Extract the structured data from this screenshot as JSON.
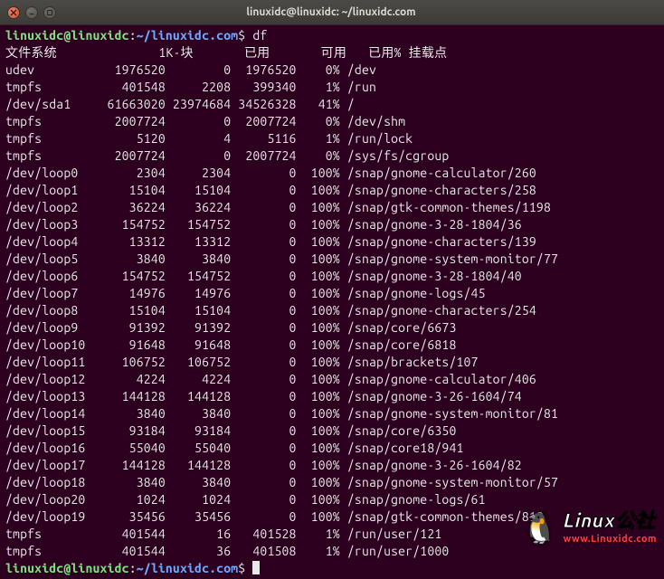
{
  "window": {
    "title": "linuxidc@linuxidc: ~/linuxidc.com"
  },
  "prompt": {
    "user_host": "linuxidc@linuxidc",
    "colon": ":",
    "path": "~/linuxidc.com",
    "dollar": "$",
    "command": "df"
  },
  "headers": {
    "filesystem": "文件系统",
    "blocks": "1K-块",
    "used": "已用",
    "avail": "可用",
    "pct": "已用%",
    "mount": "挂载点"
  },
  "rows": [
    {
      "fs": "udev",
      "blk": "1976520",
      "used": "0",
      "avail": "1976520",
      "pct": "0%",
      "mnt": "/dev"
    },
    {
      "fs": "tmpfs",
      "blk": "401548",
      "used": "2208",
      "avail": "399340",
      "pct": "1%",
      "mnt": "/run"
    },
    {
      "fs": "/dev/sda1",
      "blk": "61663020",
      "used": "23974684",
      "avail": "34526328",
      "pct": "41%",
      "mnt": "/"
    },
    {
      "fs": "tmpfs",
      "blk": "2007724",
      "used": "0",
      "avail": "2007724",
      "pct": "0%",
      "mnt": "/dev/shm"
    },
    {
      "fs": "tmpfs",
      "blk": "5120",
      "used": "4",
      "avail": "5116",
      "pct": "1%",
      "mnt": "/run/lock"
    },
    {
      "fs": "tmpfs",
      "blk": "2007724",
      "used": "0",
      "avail": "2007724",
      "pct": "0%",
      "mnt": "/sys/fs/cgroup"
    },
    {
      "fs": "/dev/loop0",
      "blk": "2304",
      "used": "2304",
      "avail": "0",
      "pct": "100%",
      "mnt": "/snap/gnome-calculator/260"
    },
    {
      "fs": "/dev/loop1",
      "blk": "15104",
      "used": "15104",
      "avail": "0",
      "pct": "100%",
      "mnt": "/snap/gnome-characters/258"
    },
    {
      "fs": "/dev/loop2",
      "blk": "36224",
      "used": "36224",
      "avail": "0",
      "pct": "100%",
      "mnt": "/snap/gtk-common-themes/1198"
    },
    {
      "fs": "/dev/loop3",
      "blk": "154752",
      "used": "154752",
      "avail": "0",
      "pct": "100%",
      "mnt": "/snap/gnome-3-28-1804/36"
    },
    {
      "fs": "/dev/loop4",
      "blk": "13312",
      "used": "13312",
      "avail": "0",
      "pct": "100%",
      "mnt": "/snap/gnome-characters/139"
    },
    {
      "fs": "/dev/loop5",
      "blk": "3840",
      "used": "3840",
      "avail": "0",
      "pct": "100%",
      "mnt": "/snap/gnome-system-monitor/77"
    },
    {
      "fs": "/dev/loop6",
      "blk": "154752",
      "used": "154752",
      "avail": "0",
      "pct": "100%",
      "mnt": "/snap/gnome-3-28-1804/40"
    },
    {
      "fs": "/dev/loop7",
      "blk": "14976",
      "used": "14976",
      "avail": "0",
      "pct": "100%",
      "mnt": "/snap/gnome-logs/45"
    },
    {
      "fs": "/dev/loop8",
      "blk": "15104",
      "used": "15104",
      "avail": "0",
      "pct": "100%",
      "mnt": "/snap/gnome-characters/254"
    },
    {
      "fs": "/dev/loop9",
      "blk": "91392",
      "used": "91392",
      "avail": "0",
      "pct": "100%",
      "mnt": "/snap/core/6673"
    },
    {
      "fs": "/dev/loop10",
      "blk": "91648",
      "used": "91648",
      "avail": "0",
      "pct": "100%",
      "mnt": "/snap/core/6818"
    },
    {
      "fs": "/dev/loop11",
      "blk": "106752",
      "used": "106752",
      "avail": "0",
      "pct": "100%",
      "mnt": "/snap/brackets/107"
    },
    {
      "fs": "/dev/loop12",
      "blk": "4224",
      "used": "4224",
      "avail": "0",
      "pct": "100%",
      "mnt": "/snap/gnome-calculator/406"
    },
    {
      "fs": "/dev/loop13",
      "blk": "144128",
      "used": "144128",
      "avail": "0",
      "pct": "100%",
      "mnt": "/snap/gnome-3-26-1604/74"
    },
    {
      "fs": "/dev/loop14",
      "blk": "3840",
      "used": "3840",
      "avail": "0",
      "pct": "100%",
      "mnt": "/snap/gnome-system-monitor/81"
    },
    {
      "fs": "/dev/loop15",
      "blk": "93184",
      "used": "93184",
      "avail": "0",
      "pct": "100%",
      "mnt": "/snap/core/6350"
    },
    {
      "fs": "/dev/loop16",
      "blk": "55040",
      "used": "55040",
      "avail": "0",
      "pct": "100%",
      "mnt": "/snap/core18/941"
    },
    {
      "fs": "/dev/loop17",
      "blk": "144128",
      "used": "144128",
      "avail": "0",
      "pct": "100%",
      "mnt": "/snap/gnome-3-26-1604/82"
    },
    {
      "fs": "/dev/loop18",
      "blk": "3840",
      "used": "3840",
      "avail": "0",
      "pct": "100%",
      "mnt": "/snap/gnome-system-monitor/57"
    },
    {
      "fs": "/dev/loop20",
      "blk": "1024",
      "used": "1024",
      "avail": "0",
      "pct": "100%",
      "mnt": "/snap/gnome-logs/61"
    },
    {
      "fs": "/dev/loop19",
      "blk": "35456",
      "used": "35456",
      "avail": "0",
      "pct": "100%",
      "mnt": "/snap/gtk-common-themes/818"
    },
    {
      "fs": "tmpfs",
      "blk": "401544",
      "used": "16",
      "avail": "401528",
      "pct": "1%",
      "mnt": "/run/user/121"
    },
    {
      "fs": "tmpfs",
      "blk": "401544",
      "used": "36",
      "avail": "401508",
      "pct": "1%",
      "mnt": "/run/user/1000"
    }
  ],
  "watermark": {
    "brand_main": "Linux",
    "brand_suffix": "公社",
    "url": "www.Linuxidc.com"
  },
  "cols": {
    "fs": 12,
    "blk": 10,
    "used": 9,
    "avail": 9,
    "pct": 5
  }
}
